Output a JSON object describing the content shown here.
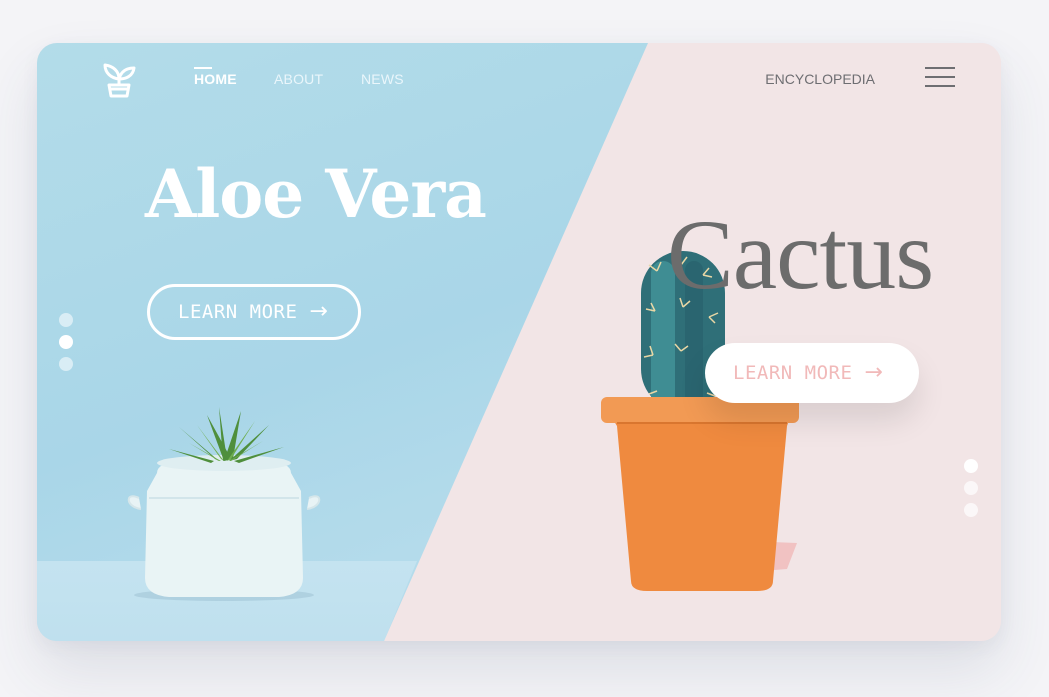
{
  "nav": {
    "links": [
      {
        "label": "HOME",
        "active": true
      },
      {
        "label": "ABOUT",
        "active": false
      },
      {
        "label": "NEWS",
        "active": false
      }
    ],
    "encyclopedia": "ENCYCLOPEDIA",
    "logo_icon": "potted-plant-icon",
    "menu_icon": "hamburger-menu-icon"
  },
  "slides": {
    "left": {
      "title": "Aloe Vera",
      "button_label": "LEARN MORE",
      "arrow": "→"
    },
    "right": {
      "title": "Cactus",
      "button_label": "LEARN MORE",
      "arrow": "→"
    }
  },
  "pagination": {
    "left": {
      "count": 3,
      "active_index": 1
    },
    "right": {
      "count": 3,
      "active_index": 0
    }
  },
  "colors": {
    "left_bg": "#a9d6e8",
    "right_bg": "#f2e5e6",
    "cactus_button_text": "#f1b9b9",
    "title_dark": "#6c6c6c"
  }
}
